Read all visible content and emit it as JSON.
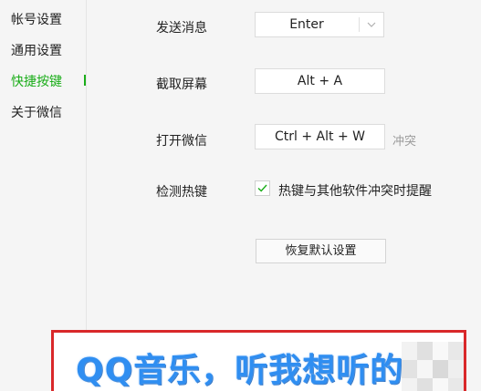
{
  "sidebar": {
    "items": [
      {
        "label": "帐号设置"
      },
      {
        "label": "通用设置"
      },
      {
        "label": "快捷按键"
      },
      {
        "label": "关于微信"
      }
    ]
  },
  "shortcuts": {
    "send": {
      "label": "发送消息",
      "key": "Enter"
    },
    "capture": {
      "label": "截取屏幕",
      "key": "Alt + A"
    },
    "open": {
      "label": "打开微信",
      "key": "Ctrl + Alt + W",
      "conflict": "冲突"
    },
    "detect": {
      "label": "检测热键",
      "option": "热键与其他软件冲突时提醒",
      "checked": true
    }
  },
  "restore_button": "恢复默认设置",
  "banner": {
    "text": "QQ音乐，听我想听的"
  },
  "colors": {
    "accent": "#1aad19",
    "banner_border": "#d9282a",
    "banner_text": "#2f8ef1"
  }
}
